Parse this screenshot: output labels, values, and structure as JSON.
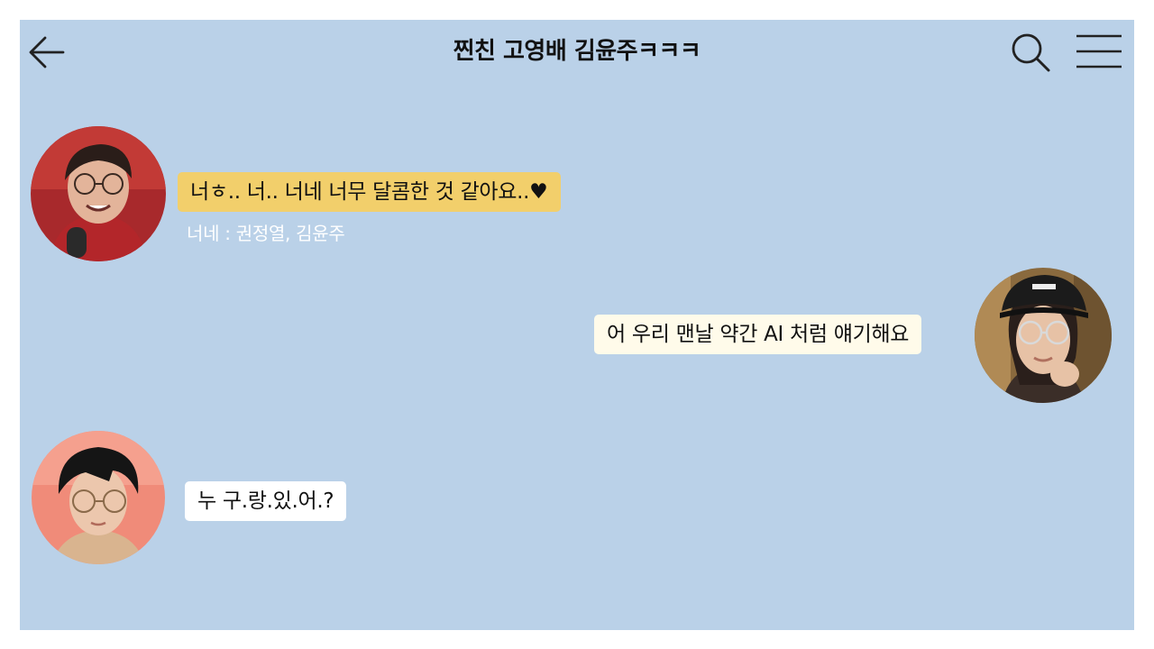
{
  "header": {
    "title": "찐친 고영배 김윤주ㅋㅋㅋ",
    "back_icon": "arrow-left-icon",
    "search_icon": "search-icon",
    "menu_icon": "hamburger-menu-icon"
  },
  "colors": {
    "chat_background": "#bad1e8",
    "bubble_yellow": "#f2cf6b",
    "bubble_cream": "#fffbea",
    "bubble_white": "#ffffff"
  },
  "messages": [
    {
      "side": "left",
      "text": "너ㅎ.. 너.. 너네 너무 달콤한 것 같아요..♥",
      "caption": "너네 : 권정열, 김윤주"
    },
    {
      "side": "right",
      "text": "어 우리 맨날 약간 AI 처럼 얘기해요"
    },
    {
      "side": "left",
      "text": "누 구.랑.있.어.?"
    }
  ]
}
